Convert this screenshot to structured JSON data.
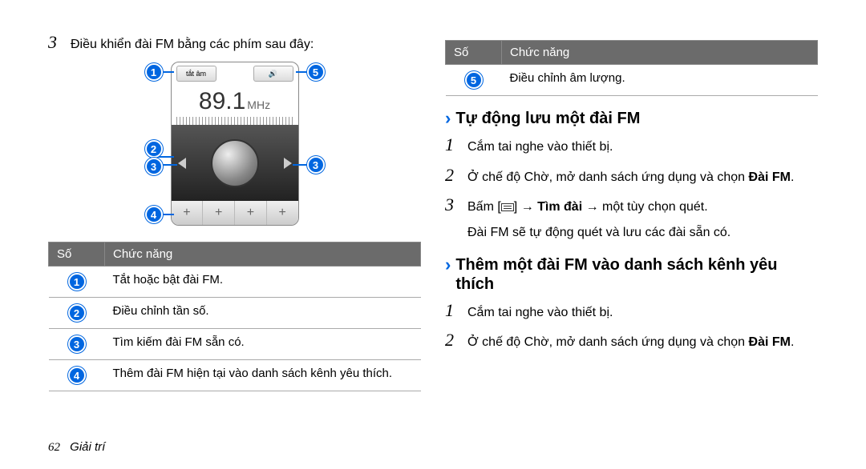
{
  "left": {
    "intro_num": "3",
    "intro_text": "Điều khiển đài FM bằng các phím sau đây:",
    "radio": {
      "freq": "89.1",
      "unit": "MHz",
      "mute": "tắt âm"
    },
    "table": {
      "h1": "Số",
      "h2": "Chức năng",
      "rows": [
        {
          "n": "1",
          "t": "Tắt hoặc bật đài FM."
        },
        {
          "n": "2",
          "t": "Điều chỉnh tần số."
        },
        {
          "n": "3",
          "t": "Tìm kiếm đài FM sẵn có."
        },
        {
          "n": "4",
          "t": "Thêm đài FM hiện tại vào danh sách kênh yêu thích."
        }
      ]
    }
  },
  "right": {
    "topTable": {
      "h1": "Số",
      "h2": "Chức năng",
      "rows": [
        {
          "n": "5",
          "t": "Điều chỉnh âm lượng."
        }
      ]
    },
    "h1": "Tự động lưu một đài FM",
    "s1": [
      {
        "n": "1",
        "t": "Cắm tai nghe vào thiết bị."
      },
      {
        "n": "2",
        "pre": "Ở chế độ Chờ, mở danh sách ứng dụng và chọn ",
        "bold": "Đài FM",
        "post": "."
      },
      {
        "n": "3",
        "pre": "Bấm [",
        "mid": "] → ",
        "bold1": "Tìm đài",
        "post1": " → một tùy chọn quét."
      }
    ],
    "note": "Đài FM sẽ tự động quét và lưu các đài sẵn có.",
    "h2": "Thêm một đài FM vào danh sách kênh yêu thích",
    "s2": [
      {
        "n": "1",
        "t": "Cắm tai nghe vào thiết bị."
      },
      {
        "n": "2",
        "pre": "Ở chế độ Chờ, mở danh sách ứng dụng và chọn ",
        "bold": "Đài FM",
        "post": "."
      }
    ]
  },
  "footer": {
    "page": "62",
    "section": "Giải trí"
  }
}
